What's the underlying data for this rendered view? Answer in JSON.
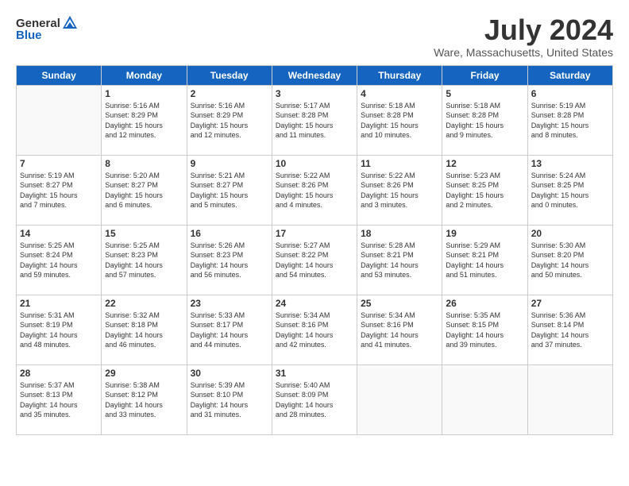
{
  "header": {
    "logo_general": "General",
    "logo_blue": "Blue",
    "title": "July 2024",
    "subtitle": "Ware, Massachusetts, United States"
  },
  "days_of_week": [
    "Sunday",
    "Monday",
    "Tuesday",
    "Wednesday",
    "Thursday",
    "Friday",
    "Saturday"
  ],
  "weeks": [
    [
      {
        "day": "",
        "info": ""
      },
      {
        "day": "1",
        "info": "Sunrise: 5:16 AM\nSunset: 8:29 PM\nDaylight: 15 hours\nand 12 minutes."
      },
      {
        "day": "2",
        "info": "Sunrise: 5:16 AM\nSunset: 8:29 PM\nDaylight: 15 hours\nand 12 minutes."
      },
      {
        "day": "3",
        "info": "Sunrise: 5:17 AM\nSunset: 8:28 PM\nDaylight: 15 hours\nand 11 minutes."
      },
      {
        "day": "4",
        "info": "Sunrise: 5:18 AM\nSunset: 8:28 PM\nDaylight: 15 hours\nand 10 minutes."
      },
      {
        "day": "5",
        "info": "Sunrise: 5:18 AM\nSunset: 8:28 PM\nDaylight: 15 hours\nand 9 minutes."
      },
      {
        "day": "6",
        "info": "Sunrise: 5:19 AM\nSunset: 8:28 PM\nDaylight: 15 hours\nand 8 minutes."
      }
    ],
    [
      {
        "day": "7",
        "info": "Sunrise: 5:19 AM\nSunset: 8:27 PM\nDaylight: 15 hours\nand 7 minutes."
      },
      {
        "day": "8",
        "info": "Sunrise: 5:20 AM\nSunset: 8:27 PM\nDaylight: 15 hours\nand 6 minutes."
      },
      {
        "day": "9",
        "info": "Sunrise: 5:21 AM\nSunset: 8:27 PM\nDaylight: 15 hours\nand 5 minutes."
      },
      {
        "day": "10",
        "info": "Sunrise: 5:22 AM\nSunset: 8:26 PM\nDaylight: 15 hours\nand 4 minutes."
      },
      {
        "day": "11",
        "info": "Sunrise: 5:22 AM\nSunset: 8:26 PM\nDaylight: 15 hours\nand 3 minutes."
      },
      {
        "day": "12",
        "info": "Sunrise: 5:23 AM\nSunset: 8:25 PM\nDaylight: 15 hours\nand 2 minutes."
      },
      {
        "day": "13",
        "info": "Sunrise: 5:24 AM\nSunset: 8:25 PM\nDaylight: 15 hours\nand 0 minutes."
      }
    ],
    [
      {
        "day": "14",
        "info": "Sunrise: 5:25 AM\nSunset: 8:24 PM\nDaylight: 14 hours\nand 59 minutes."
      },
      {
        "day": "15",
        "info": "Sunrise: 5:25 AM\nSunset: 8:23 PM\nDaylight: 14 hours\nand 57 minutes."
      },
      {
        "day": "16",
        "info": "Sunrise: 5:26 AM\nSunset: 8:23 PM\nDaylight: 14 hours\nand 56 minutes."
      },
      {
        "day": "17",
        "info": "Sunrise: 5:27 AM\nSunset: 8:22 PM\nDaylight: 14 hours\nand 54 minutes."
      },
      {
        "day": "18",
        "info": "Sunrise: 5:28 AM\nSunset: 8:21 PM\nDaylight: 14 hours\nand 53 minutes."
      },
      {
        "day": "19",
        "info": "Sunrise: 5:29 AM\nSunset: 8:21 PM\nDaylight: 14 hours\nand 51 minutes."
      },
      {
        "day": "20",
        "info": "Sunrise: 5:30 AM\nSunset: 8:20 PM\nDaylight: 14 hours\nand 50 minutes."
      }
    ],
    [
      {
        "day": "21",
        "info": "Sunrise: 5:31 AM\nSunset: 8:19 PM\nDaylight: 14 hours\nand 48 minutes."
      },
      {
        "day": "22",
        "info": "Sunrise: 5:32 AM\nSunset: 8:18 PM\nDaylight: 14 hours\nand 46 minutes."
      },
      {
        "day": "23",
        "info": "Sunrise: 5:33 AM\nSunset: 8:17 PM\nDaylight: 14 hours\nand 44 minutes."
      },
      {
        "day": "24",
        "info": "Sunrise: 5:34 AM\nSunset: 8:16 PM\nDaylight: 14 hours\nand 42 minutes."
      },
      {
        "day": "25",
        "info": "Sunrise: 5:34 AM\nSunset: 8:16 PM\nDaylight: 14 hours\nand 41 minutes."
      },
      {
        "day": "26",
        "info": "Sunrise: 5:35 AM\nSunset: 8:15 PM\nDaylight: 14 hours\nand 39 minutes."
      },
      {
        "day": "27",
        "info": "Sunrise: 5:36 AM\nSunset: 8:14 PM\nDaylight: 14 hours\nand 37 minutes."
      }
    ],
    [
      {
        "day": "28",
        "info": "Sunrise: 5:37 AM\nSunset: 8:13 PM\nDaylight: 14 hours\nand 35 minutes."
      },
      {
        "day": "29",
        "info": "Sunrise: 5:38 AM\nSunset: 8:12 PM\nDaylight: 14 hours\nand 33 minutes."
      },
      {
        "day": "30",
        "info": "Sunrise: 5:39 AM\nSunset: 8:10 PM\nDaylight: 14 hours\nand 31 minutes."
      },
      {
        "day": "31",
        "info": "Sunrise: 5:40 AM\nSunset: 8:09 PM\nDaylight: 14 hours\nand 28 minutes."
      },
      {
        "day": "",
        "info": ""
      },
      {
        "day": "",
        "info": ""
      },
      {
        "day": "",
        "info": ""
      }
    ]
  ]
}
